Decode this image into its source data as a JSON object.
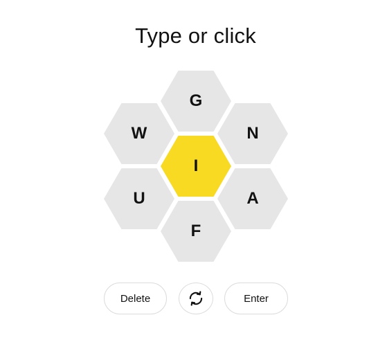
{
  "prompt": "Type or click",
  "hive": {
    "center_letter": "I",
    "outer_letters": {
      "top": "G",
      "upper_left": "W",
      "upper_right": "N",
      "lower_left": "U",
      "lower_right": "A",
      "bottom": "F"
    },
    "colors": {
      "center": "#f7da21",
      "outer": "#e6e6e6"
    }
  },
  "controls": {
    "delete_label": "Delete",
    "shuffle_icon": "shuffle-icon",
    "enter_label": "Enter"
  }
}
